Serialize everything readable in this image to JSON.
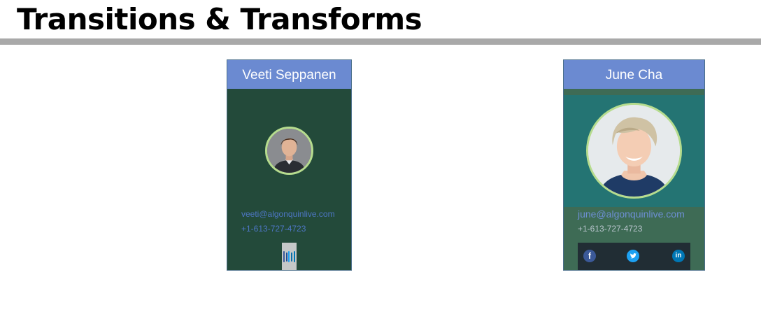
{
  "page": {
    "title": "Transitions & Transforms"
  },
  "cards": [
    {
      "name": "Veeti Seppanen",
      "email": "veeti@algonquinlive.com",
      "phone": "+1-613-727-4723",
      "social_icons": [
        "facebook-icon",
        "twitter-icon",
        "linkedin-icon"
      ]
    },
    {
      "name": "June Cha",
      "email": "june@algonquinlive.com",
      "phone": "+1-613-727-4723",
      "social": {
        "facebook": "f",
        "twitter": "t",
        "linkedin": "in"
      }
    }
  ],
  "colors": {
    "header": "#6b8ad1",
    "card_one_bg": "#234a3a",
    "card_two_bg": "#3e6b55",
    "photo_band": "#247473",
    "avatar_ring": "#b6dc8e",
    "social_bar": "#212d34",
    "facebook": "#3b5998",
    "twitter": "#1da1f2",
    "linkedin": "#0077b5"
  }
}
